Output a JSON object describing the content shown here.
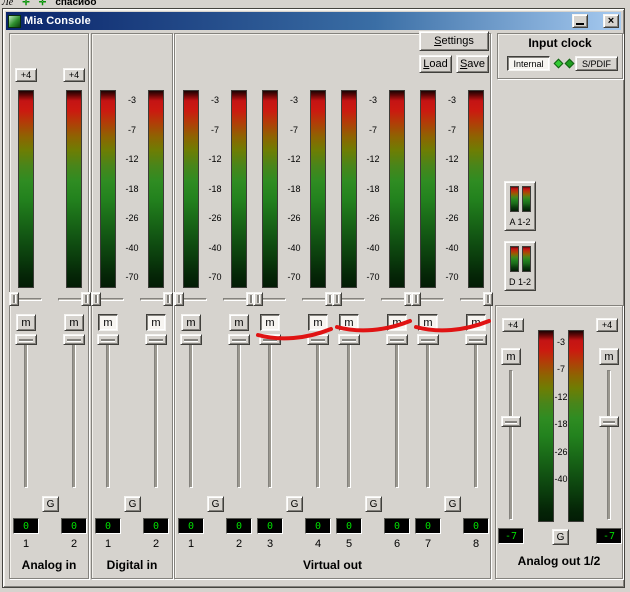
{
  "background": {
    "fragment_left": "Ле",
    "icon1": "✛",
    "icon2": "✛",
    "fragment_text": "спасибо"
  },
  "window": {
    "title": "Mia Console",
    "close_glyph": "×"
  },
  "buttons": {
    "settings": "Settings",
    "load": "Load",
    "save": "Save"
  },
  "labels": {
    "mute": "m",
    "gang": "G"
  },
  "scale_labels": [
    "-3",
    "-7",
    "-12",
    "-18",
    "-26",
    "-40",
    "-70"
  ],
  "groups": [
    {
      "label": "Analog in",
      "pairs": [
        {
          "plus4": "+4",
          "scale": false,
          "scribble": false,
          "channels": [
            {
              "num": "1",
              "value": "0",
              "pan": "left",
              "muted": false
            },
            {
              "num": "2",
              "value": "0",
              "pan": "right",
              "muted": false
            }
          ]
        }
      ]
    },
    {
      "label": "Digital in",
      "pairs": [
        {
          "plus4": null,
          "scale": true,
          "scribble": false,
          "channels": [
            {
              "num": "1",
              "value": "0",
              "pan": "left",
              "muted": true
            },
            {
              "num": "2",
              "value": "0",
              "pan": "right",
              "muted": true
            }
          ]
        }
      ]
    },
    {
      "label": "Virtual out",
      "pairs": [
        {
          "plus4": null,
          "scale": true,
          "scribble": false,
          "channels": [
            {
              "num": "1",
              "value": "0",
              "pan": "left",
              "muted": false
            },
            {
              "num": "2",
              "value": "0",
              "pan": "right",
              "muted": false
            }
          ]
        },
        {
          "plus4": null,
          "scale": true,
          "scribble": true,
          "channels": [
            {
              "num": "3",
              "value": "0",
              "pan": "left",
              "muted": true
            },
            {
              "num": "4",
              "value": "0",
              "pan": "right",
              "muted": true
            }
          ]
        },
        {
          "plus4": null,
          "scale": true,
          "scribble": true,
          "channels": [
            {
              "num": "5",
              "value": "0",
              "pan": "left",
              "muted": true
            },
            {
              "num": "6",
              "value": "0",
              "pan": "right",
              "muted": true
            }
          ]
        },
        {
          "plus4": null,
          "scale": true,
          "scribble": true,
          "channels": [
            {
              "num": "7",
              "value": "0",
              "pan": "left",
              "muted": true
            },
            {
              "num": "8",
              "value": "0",
              "pan": "right",
              "muted": true
            }
          ]
        }
      ]
    }
  ],
  "input_clock": {
    "title": "Input clock",
    "internal": "Internal",
    "spdif": "S/PDIF"
  },
  "monitors": [
    {
      "label": "A 1-2"
    },
    {
      "label": "D 1-2"
    }
  ],
  "analog_out": {
    "title": "Analog out 1/2",
    "plus4": "+4",
    "left_value": "-7",
    "right_value": "-7",
    "scale_labels": [
      "-3",
      "-7",
      "-12",
      "-18",
      "-26",
      "-40"
    ]
  },
  "colors": {
    "annotation_red": "#e01313",
    "led_green": "#33cc33",
    "display_green": "#00dc00",
    "titlebar_start": "#0a246a",
    "titlebar_end": "#a6caf0"
  }
}
